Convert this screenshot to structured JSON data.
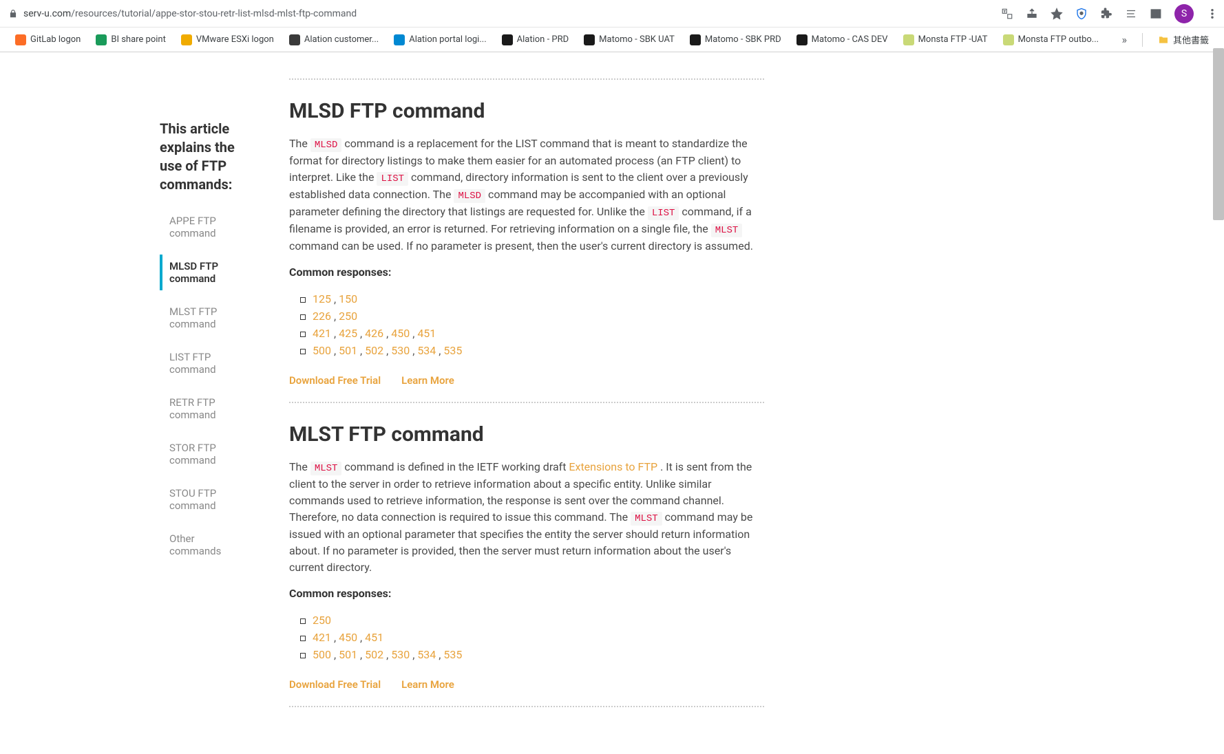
{
  "browser": {
    "url_host": "serv-u.com",
    "url_path": "/resources/tutorial/appe-stor-stou-retr-list-mlsd-mlst-ftp-command",
    "avatar_letter": "S"
  },
  "bookmarks": [
    {
      "label": "GitLab logon",
      "color": "#fc6d26"
    },
    {
      "label": "BI share point",
      "color": "#1a9b5a"
    },
    {
      "label": "VMware ESXi logon",
      "color": "#f0ab00"
    },
    {
      "label": "Alation customer...",
      "color": "#3a3a3a"
    },
    {
      "label": "Alation portal logi...",
      "color": "#0088d2"
    },
    {
      "label": "Alation - PRD",
      "color": "#1a1a1a"
    },
    {
      "label": "Matomo - SBK UAT",
      "color": "#1a1a1a"
    },
    {
      "label": "Matomo - SBK PRD",
      "color": "#1a1a1a"
    },
    {
      "label": "Matomo - CAS DEV",
      "color": "#1a1a1a"
    },
    {
      "label": "Monsta FTP -UAT",
      "color": "#c9d977"
    },
    {
      "label": "Monsta FTP outbo...",
      "color": "#c9d977"
    }
  ],
  "bookmarks_folder": "其他書籤",
  "sidebar": {
    "title": "This article explains the use of FTP commands:",
    "items": [
      {
        "label": "APPE FTP command",
        "active": false
      },
      {
        "label": "MLSD FTP command",
        "active": true
      },
      {
        "label": "MLST FTP command",
        "active": false
      },
      {
        "label": "LIST FTP command",
        "active": false
      },
      {
        "label": "RETR FTP command",
        "active": false
      },
      {
        "label": "STOR FTP command",
        "active": false
      },
      {
        "label": "STOU FTP command",
        "active": false
      },
      {
        "label": "Other commands",
        "active": false
      }
    ]
  },
  "sections": [
    {
      "heading": "MLSD FTP command",
      "body_html": "The <span class='code'>MLSD</span> command is a replacement for the LIST command that is meant to standardize the format for directory listings to make them easier for an automated process (an FTP client) to interpret. Like the <span class='code'>LIST</span> command, directory information is sent to the client over a previously established data connection. The <span class='code'>MLSD</span> command may be accompanied with an optional parameter defining the directory that listings are requested for. Unlike the <span class='code'>LIST</span> command, if a filename is provided, an error is returned. For retrieving information on a single file, the <span class='code'>MLST</span> command can be used. If no parameter is present, then the user's current directory is assumed.",
      "responses_label": "Common responses:",
      "responses": [
        [
          "125",
          "150"
        ],
        [
          "226",
          "250"
        ],
        [
          "421",
          "425",
          "426",
          "450",
          "451"
        ],
        [
          "500",
          "501",
          "502",
          "530",
          "534",
          "535"
        ]
      ],
      "cta": [
        {
          "label": "Download Free Trial"
        },
        {
          "label": "Learn More"
        }
      ]
    },
    {
      "heading": "MLST FTP command",
      "body_html": "The <span class='code'>MLST</span> command is defined in the IETF working draft <span class='link-inline'>Extensions to FTP</span> . It is sent from the client to the server in order to retrieve information about a specific entity. Unlike similar commands used to retrieve information, the response is sent over the command channel. Therefore, no data connection is required to issue this command. The <span class='code'>MLST</span> command may be issued with an optional parameter that specifies the entity the server should return information about. If no parameter is provided, then the server must return information about the user's current directory.",
      "responses_label": "Common responses:",
      "responses": [
        [
          "250"
        ],
        [
          "421",
          "450",
          "451"
        ],
        [
          "500",
          "501",
          "502",
          "530",
          "534",
          "535"
        ]
      ],
      "cta": [
        {
          "label": "Download Free Trial"
        },
        {
          "label": "Learn More"
        }
      ]
    }
  ]
}
